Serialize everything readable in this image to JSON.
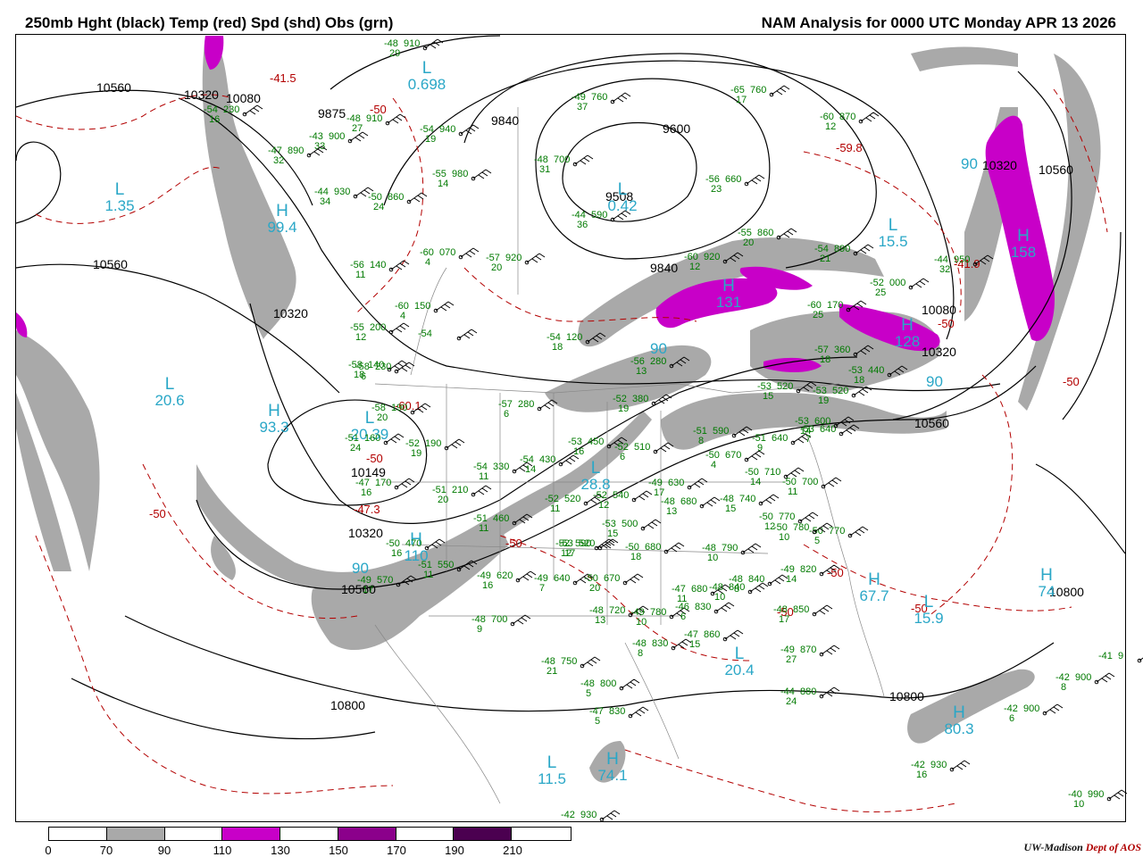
{
  "title_left": "250mb Hght (black) Temp (red) Spd (shd) Obs (grn)",
  "title_right": "NAM Analysis for 0000 UTC Monday  APR 13 2026",
  "colors": {
    "height_contour": "#000000",
    "temp_contour": "#b30000",
    "speed_70_90": "#a9a9a9",
    "speed_110_130": "#c800c8",
    "speed_150_170": "#8b008b",
    "speed_190_210": "#4b0050",
    "obs": "#007a00",
    "pressure_label": "#2aa7c7"
  },
  "height_labels": [
    "10560",
    "10320",
    "10080",
    "9875",
    "9840",
    "9600",
    "9508",
    "10560",
    "10320",
    "10149",
    "10320",
    "10560",
    "10800",
    "10800",
    "10320",
    "10560",
    "9840",
    "10080",
    "10320",
    "10560",
    "10800"
  ],
  "temp_labels": [
    "-41.5",
    "-50",
    "-59.8",
    "-41.9",
    "-50",
    "-50",
    "-60.1",
    "-50",
    "-47.3",
    "-50",
    "-50",
    "-50",
    "-50",
    "-50"
  ],
  "pressure_centers": [
    {
      "type": "L",
      "value": "0.698"
    },
    {
      "type": "L",
      "value": "1.35"
    },
    {
      "type": "H",
      "value": "99.4"
    },
    {
      "type": "L",
      "value": "0.42"
    },
    {
      "type": "L",
      "value": "15.5"
    },
    {
      "type": "H",
      "value": "158"
    },
    {
      "type": "H",
      "value": "131"
    },
    {
      "type": "H",
      "value": "128"
    },
    {
      "type": "L",
      "value": "20.6"
    },
    {
      "type": "H",
      "value": "93.3"
    },
    {
      "type": "L",
      "value": "20.39"
    },
    {
      "type": "L",
      "value": "28.8"
    },
    {
      "type": "H",
      "value": "110"
    },
    {
      "type": "L",
      "value": "20.4"
    },
    {
      "type": "H",
      "value": "67.7"
    },
    {
      "type": "L",
      "value": "15.9"
    },
    {
      "type": "H",
      "value": "74"
    },
    {
      "type": "H",
      "value": "80.3"
    },
    {
      "type": "L",
      "value": "11.5"
    },
    {
      "type": "H",
      "value": "74.1"
    }
  ],
  "speed_labels": [
    "90",
    "90",
    "90",
    "90",
    "90"
  ],
  "observations": [
    {
      "temp": "-48",
      "hgt": "910",
      "wind": "29"
    },
    {
      "temp": "-54",
      "hgt": "230",
      "wind": "16"
    },
    {
      "temp": "-48",
      "hgt": "910",
      "wind": "27"
    },
    {
      "temp": "-43",
      "hgt": "900",
      "wind": "33"
    },
    {
      "temp": "-47",
      "hgt": "890",
      "wind": "32"
    },
    {
      "temp": "-44",
      "hgt": "930",
      "wind": "34"
    },
    {
      "temp": "-50",
      "hgt": "860",
      "wind": "24"
    },
    {
      "temp": "-54",
      "hgt": "940",
      "wind": "19"
    },
    {
      "temp": "-49",
      "hgt": "760",
      "wind": "37"
    },
    {
      "temp": "-48",
      "hgt": "700",
      "wind": "31"
    },
    {
      "temp": "-55",
      "hgt": "980",
      "wind": "14"
    },
    {
      "temp": "-44",
      "hgt": "590",
      "wind": "36"
    },
    {
      "temp": "-65",
      "hgt": "760",
      "wind": "17"
    },
    {
      "temp": "-60",
      "hgt": "870",
      "wind": "12"
    },
    {
      "temp": "-56",
      "hgt": "660",
      "wind": "23"
    },
    {
      "temp": "-60",
      "hgt": "070",
      "wind": "4"
    },
    {
      "temp": "-57",
      "hgt": "920",
      "wind": "20"
    },
    {
      "temp": "-56",
      "hgt": "140",
      "wind": "11"
    },
    {
      "temp": "-60",
      "hgt": "150",
      "wind": "4"
    },
    {
      "temp": "-55",
      "hgt": "200",
      "wind": "12"
    },
    {
      "temp": "-58",
      "hgt": "140",
      "wind": "18"
    },
    {
      "temp": "-58",
      "hgt": "230",
      "wind": "6"
    },
    {
      "temp": "-54",
      "hgt": "120",
      "wind": "18"
    },
    {
      "temp": "-56",
      "hgt": "280",
      "wind": "13"
    },
    {
      "temp": "-52",
      "hgt": "380",
      "wind": "19"
    },
    {
      "temp": "-57",
      "hgt": "280",
      "wind": "6"
    },
    {
      "temp": "-51",
      "hgt": "160",
      "wind": "24"
    },
    {
      "temp": "-52",
      "hgt": "190",
      "wind": "19"
    },
    {
      "temp": "-58",
      "hgt": "190",
      "wind": "20"
    },
    {
      "temp": "-47",
      "hgt": "170",
      "wind": "16"
    },
    {
      "temp": "-54",
      "hgt": "330",
      "wind": "11"
    },
    {
      "temp": "-54",
      "hgt": "430",
      "wind": "14"
    },
    {
      "temp": "-53",
      "hgt": "450",
      "wind": "16"
    },
    {
      "temp": "-52",
      "hgt": "510",
      "wind": "6"
    },
    {
      "temp": "-51",
      "hgt": "590",
      "wind": "8"
    },
    {
      "temp": "-51",
      "hgt": "640",
      "wind": "9"
    },
    {
      "temp": "-53",
      "hgt": "640",
      "wind": "7"
    },
    {
      "temp": "-51",
      "hgt": "210",
      "wind": "20"
    },
    {
      "temp": "-51",
      "hgt": "460",
      "wind": "11"
    },
    {
      "temp": "-52",
      "hgt": "520",
      "wind": "11"
    },
    {
      "temp": "-52",
      "hgt": "540",
      "wind": "12"
    },
    {
      "temp": "-49",
      "hgt": "630",
      "wind": "17"
    },
    {
      "temp": "-48",
      "hgt": "680",
      "wind": "13"
    },
    {
      "temp": "-50",
      "hgt": "670",
      "wind": "4"
    },
    {
      "temp": "-50",
      "hgt": "710",
      "wind": "14"
    },
    {
      "temp": "-50",
      "hgt": "700",
      "wind": "11"
    },
    {
      "temp": "-48",
      "hgt": "740",
      "wind": "15"
    },
    {
      "temp": "-53",
      "hgt": "600",
      "wind": "14"
    },
    {
      "temp": "-53",
      "hgt": "500",
      "wind": "15"
    },
    {
      "temp": "-53",
      "hgt": "520",
      "wind": "17"
    },
    {
      "temp": "-50",
      "hgt": "470",
      "wind": "16"
    },
    {
      "temp": "-51",
      "hgt": "550",
      "wind": "11"
    },
    {
      "temp": "-49",
      "hgt": "570",
      "wind": "17"
    },
    {
      "temp": "-52",
      "hgt": "590",
      "wind": "12"
    },
    {
      "temp": "-50",
      "hgt": "680",
      "wind": "18"
    },
    {
      "temp": "-49",
      "hgt": "620",
      "wind": "16"
    },
    {
      "temp": "-49",
      "hgt": "640",
      "wind": "7"
    },
    {
      "temp": "-50",
      "hgt": "670",
      "wind": "20"
    },
    {
      "temp": "-47",
      "hgt": "680",
      "wind": "11"
    },
    {
      "temp": "-48",
      "hgt": "790",
      "wind": "10"
    },
    {
      "temp": "-50",
      "hgt": "770",
      "wind": "12"
    },
    {
      "temp": "-50",
      "hgt": "770",
      "wind": "5"
    },
    {
      "temp": "-50",
      "hgt": "780",
      "wind": "10"
    },
    {
      "temp": "-48",
      "hgt": "840",
      "wind": "10"
    },
    {
      "temp": "-48",
      "hgt": "840",
      "wind": "8"
    },
    {
      "temp": "-49",
      "hgt": "820",
      "wind": "14"
    },
    {
      "temp": "-48",
      "hgt": "850",
      "wind": "17"
    },
    {
      "temp": "-48",
      "hgt": "700",
      "wind": "9"
    },
    {
      "temp": "-48",
      "hgt": "720",
      "wind": "13"
    },
    {
      "temp": "-49",
      "hgt": "780",
      "wind": "10"
    },
    {
      "temp": "-46",
      "hgt": "830",
      "wind": "6"
    },
    {
      "temp": "-47",
      "hgt": "860",
      "wind": "15"
    },
    {
      "temp": "-48",
      "hgt": "830",
      "wind": "8"
    },
    {
      "temp": "-49",
      "hgt": "870",
      "wind": "27"
    },
    {
      "temp": "-48",
      "hgt": "750",
      "wind": "21"
    },
    {
      "temp": "-48",
      "hgt": "800",
      "wind": "5"
    },
    {
      "temp": "-47",
      "hgt": "830",
      "wind": "5"
    },
    {
      "temp": "-44",
      "hgt": "880",
      "wind": "24"
    },
    {
      "temp": "-42",
      "hgt": "900",
      "wind": "8"
    },
    {
      "temp": "-42",
      "hgt": "900",
      "wind": "6"
    },
    {
      "temp": "-41",
      "hgt": "9",
      "wind": ""
    },
    {
      "temp": "-42",
      "hgt": "930",
      "wind": "16"
    },
    {
      "temp": "-40",
      "hgt": "990",
      "wind": "10"
    },
    {
      "temp": "-42",
      "hgt": "930",
      "wind": ""
    },
    {
      "temp": "-54",
      "hgt": "890",
      "wind": "21"
    },
    {
      "temp": "-44",
      "hgt": "950",
      "wind": "32"
    },
    {
      "temp": "-55",
      "hgt": "860",
      "wind": "20"
    },
    {
      "temp": "-60",
      "hgt": "920",
      "wind": "12"
    },
    {
      "temp": "-60",
      "hgt": "170",
      "wind": "25"
    },
    {
      "temp": "-52",
      "hgt": "000",
      "wind": "25"
    },
    {
      "temp": "-57",
      "hgt": "360",
      "wind": "18"
    },
    {
      "temp": "-53",
      "hgt": "440",
      "wind": "18"
    },
    {
      "temp": "-53",
      "hgt": "520",
      "wind": "15"
    },
    {
      "temp": "-53",
      "hgt": "520",
      "wind": "19"
    },
    {
      "temp": "-54",
      "hgt": "",
      "wind": ""
    }
  ],
  "legend": {
    "ticks": [
      "0",
      "70",
      "90",
      "110",
      "130",
      "150",
      "170",
      "190",
      "210"
    ]
  },
  "credit": {
    "org": "UW-Madison",
    "dept": "Dept of AOS"
  }
}
